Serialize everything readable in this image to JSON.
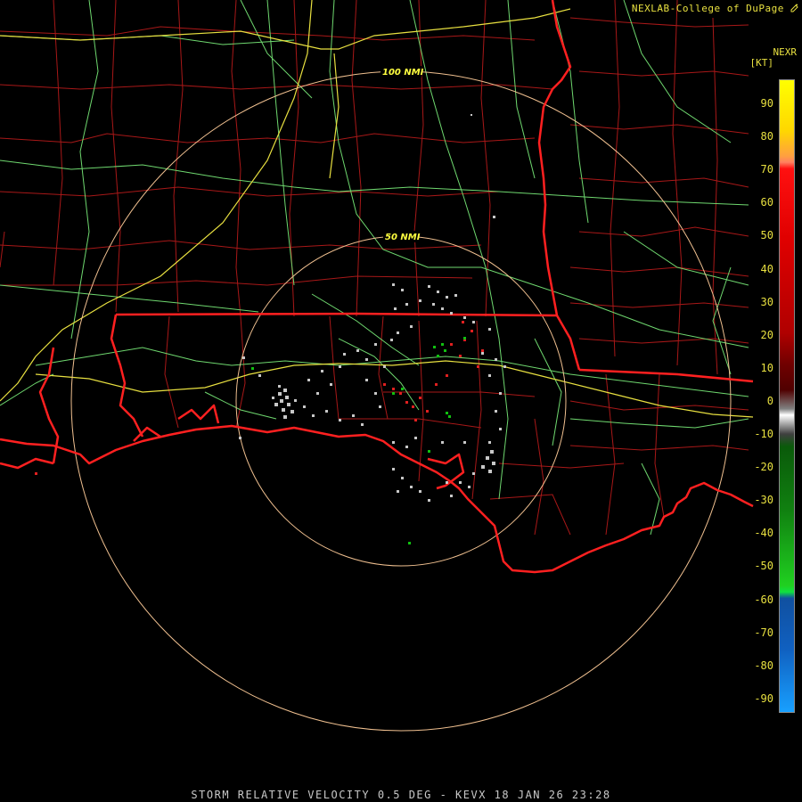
{
  "credit": "NEXLAB-College of DuPage",
  "credit_icon": "pencil-icon",
  "product_code": "NEXR",
  "units": "[KT]",
  "caption": "STORM RELATIVE VELOCITY 0.5 DEG - KEVX 18 JAN 26 23:28",
  "range_rings": [
    {
      "label": "50 NMI"
    },
    {
      "label": "100 NMI"
    }
  ],
  "scale": {
    "ticks": [
      "90",
      "80",
      "70",
      "60",
      "50",
      "40",
      "30",
      "20",
      "10",
      "0",
      "-10",
      "-20",
      "-30",
      "-40",
      "-50",
      "-60",
      "-70",
      "-80",
      "-90"
    ]
  },
  "colors": {
    "background": "#000000",
    "state_borders": "#ff2020",
    "county_borders": "#b01818",
    "roads": "#7fe07f",
    "interstates": "#e8e040",
    "range_rings": "#f0c080",
    "label_text": "#e8e040",
    "inbound": "#10c010",
    "outbound": "#e02020",
    "near_zero": "#c8c8c8"
  }
}
